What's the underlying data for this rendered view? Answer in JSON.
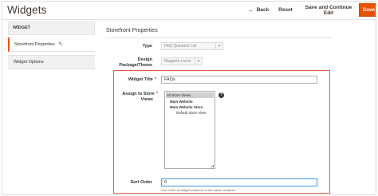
{
  "header": {
    "title": "Widgets",
    "back_label": "Back",
    "back_icon": "arrow-left-icon",
    "reset_label": "Reset",
    "save_continue_label": "Save and Continue Edit",
    "save_label": "Save"
  },
  "sidebar": {
    "heading": "WIDGET",
    "items": [
      {
        "label": "Storefront Properties",
        "active": true,
        "icon": "pencil-icon"
      },
      {
        "label": "Widget Options",
        "active": false
      }
    ]
  },
  "main": {
    "section_title": "Storefront Properties",
    "fields": {
      "type": {
        "label": "Type",
        "value": "FAQ Question List"
      },
      "design_theme": {
        "label_line1": "Design",
        "label_line2": "Package/Theme",
        "value": "Magento Luma"
      },
      "widget_title": {
        "label": "Widget Title",
        "required": "*",
        "value": "FAQs"
      },
      "store_views": {
        "label_line1": "Assign to Store",
        "label_line2": "Views",
        "required": "*",
        "options": [
          {
            "label": "All Store Views",
            "selected": true
          },
          {
            "label": "Main Website",
            "group": true
          },
          {
            "label": "Main Website Store",
            "group": true
          },
          {
            "label": "Default Store View"
          }
        ],
        "help_icon": "question-circle-icon",
        "help_glyph": "?"
      },
      "sort_order": {
        "label": "Sort Order",
        "value": "0",
        "note": "Sort Order of widget instances in the same container"
      }
    },
    "colors": {
      "accent": "#eb5202",
      "highlight_border": "#e35b4d",
      "focus_border": "#4f9ee8",
      "required": "#e22626"
    }
  }
}
